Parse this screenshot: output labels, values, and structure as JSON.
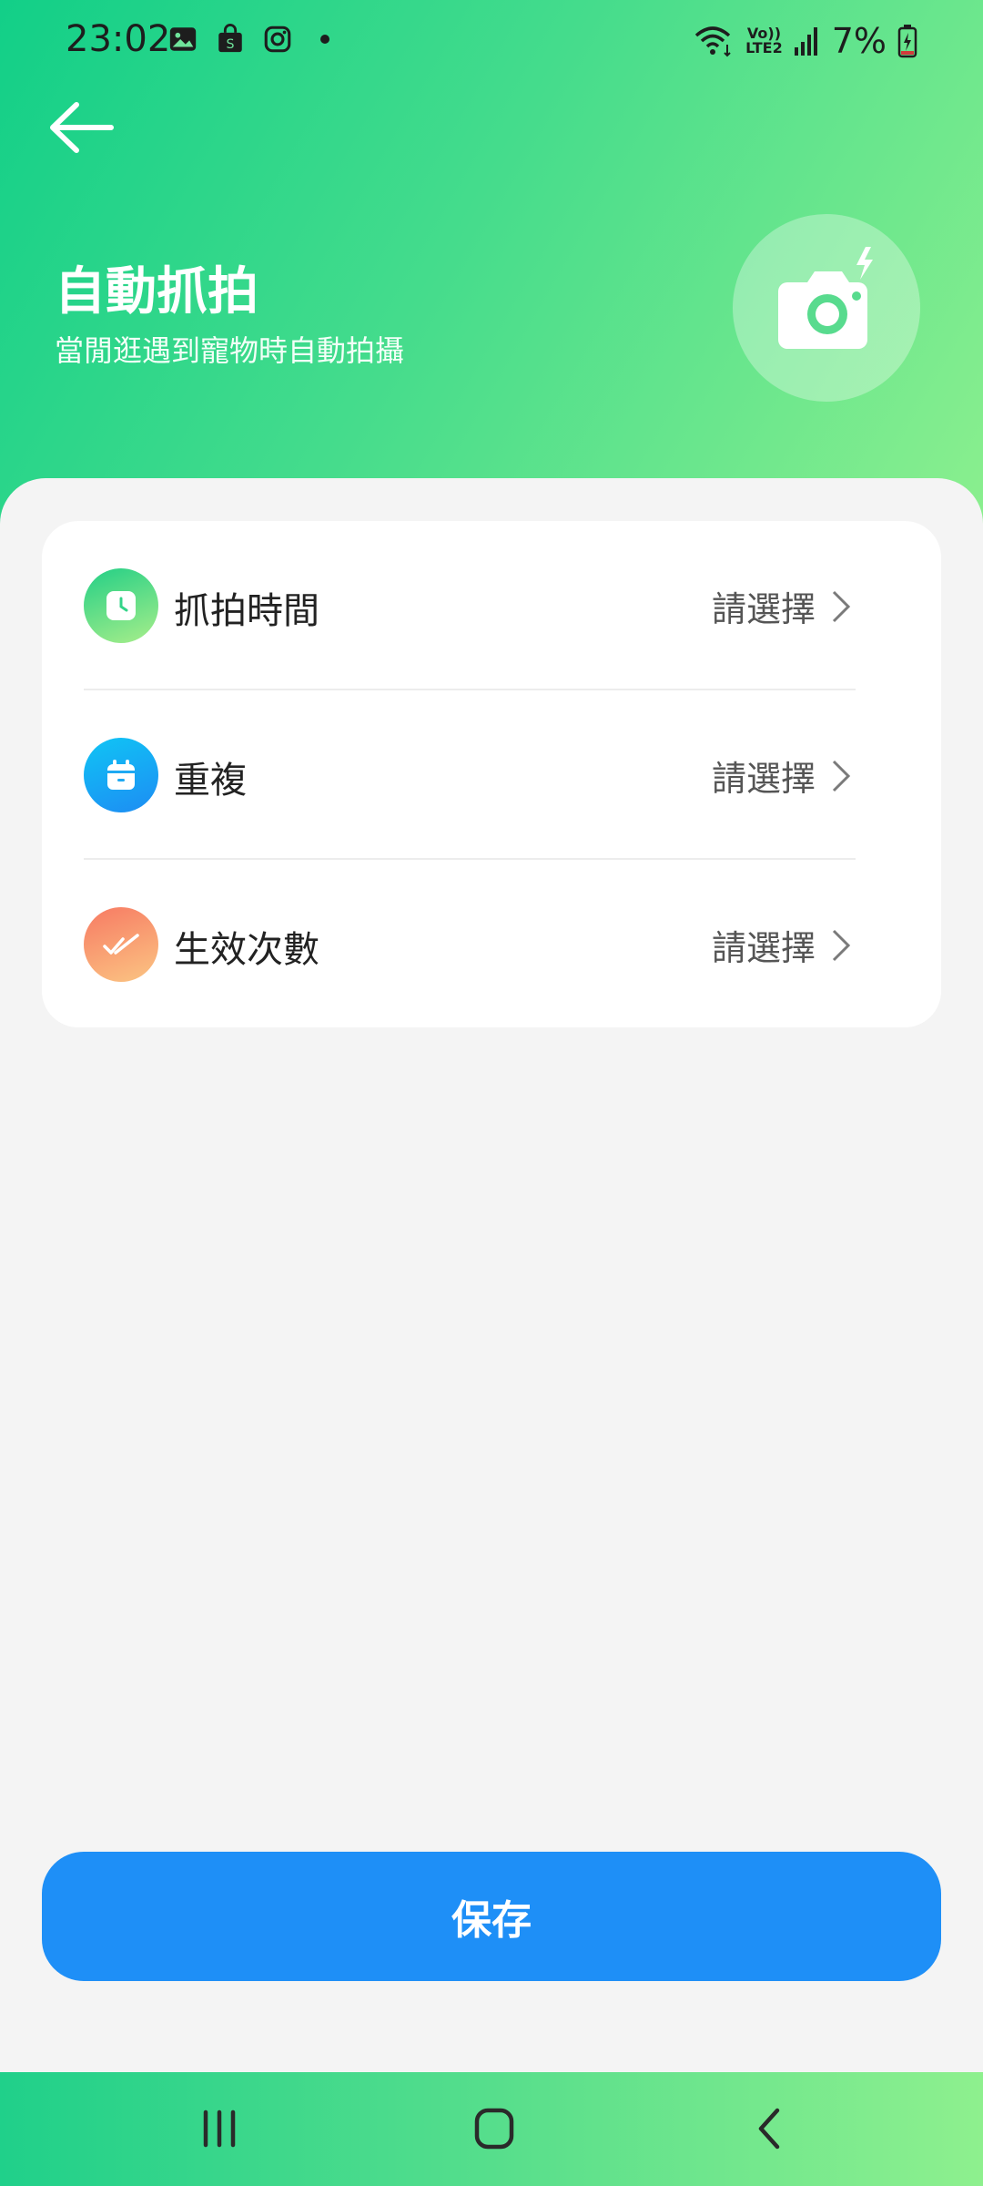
{
  "status_bar": {
    "time": "23:02",
    "notification_icons": [
      "gallery-icon",
      "shop-bag-icon",
      "instagram-icon",
      "more-dot-icon"
    ],
    "network_label_top": "Vo))",
    "network_label_bottom": "LTE2",
    "battery_percent": "7%"
  },
  "header": {
    "back_icon": "back-arrow-icon",
    "title": "自動抓拍",
    "subtitle": "當閒逛遇到寵物時自動拍攝",
    "badge_icon": "camera-flash-icon"
  },
  "settings": {
    "items": [
      {
        "label": "抓拍時間",
        "value": "請選擇",
        "icon": "clock-icon"
      },
      {
        "label": "重複",
        "value": "請選擇",
        "icon": "calendar-icon"
      },
      {
        "label": "生效次數",
        "value": "請選擇",
        "icon": "double-check-icon"
      }
    ]
  },
  "save_label": "保存",
  "nav_bar": {
    "buttons": [
      "recent-apps-icon",
      "home-icon",
      "nav-back-icon"
    ]
  },
  "colors": {
    "accent": "#1e8ff7",
    "header_gradient_start": "#12cf88",
    "header_gradient_end": "#8ef08e",
    "clock_icon_bg": "#3fd58a",
    "calendar_icon_bg": "#1aa6f5",
    "check_icon_bg": "#f7906c"
  }
}
